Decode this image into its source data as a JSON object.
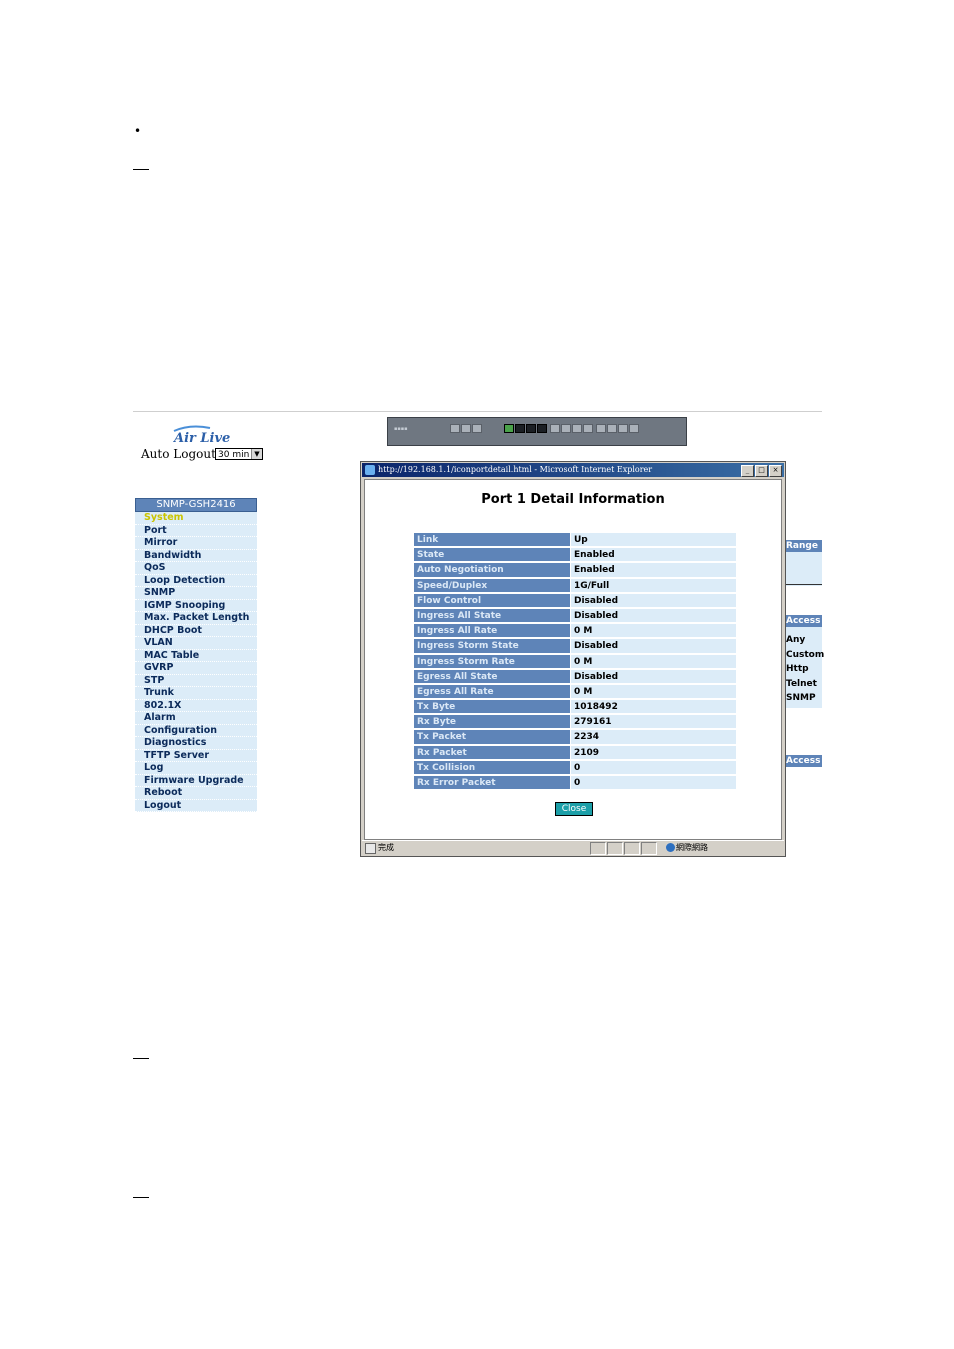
{
  "doc": {
    "bullet": "•"
  },
  "logo": {
    "text": "Air Live"
  },
  "auto_logout": {
    "label": "Auto Logout",
    "value": "30 min"
  },
  "sidebar": {
    "title": "SNMP-GSH2416",
    "items": [
      {
        "label": "System",
        "active": true
      },
      {
        "label": "Port"
      },
      {
        "label": "Mirror"
      },
      {
        "label": "Bandwidth"
      },
      {
        "label": "QoS"
      },
      {
        "label": "Loop Detection"
      },
      {
        "label": "SNMP"
      },
      {
        "label": "IGMP Snooping"
      },
      {
        "label": "Max. Packet Length"
      },
      {
        "label": "DHCP Boot"
      },
      {
        "label": "VLAN"
      },
      {
        "label": "MAC Table"
      },
      {
        "label": "GVRP"
      },
      {
        "label": "STP"
      },
      {
        "label": "Trunk"
      },
      {
        "label": "802.1X"
      },
      {
        "label": "Alarm"
      },
      {
        "label": "Configuration"
      },
      {
        "label": "Diagnostics"
      },
      {
        "label": "TFTP Server"
      },
      {
        "label": "Log"
      },
      {
        "label": "Firmware Upgrade"
      },
      {
        "label": "Reboot"
      },
      {
        "label": "Logout"
      }
    ]
  },
  "background_right": {
    "range_header": "Range",
    "access_header": "Access",
    "access_items": [
      "Any",
      "Custom",
      "Http",
      "Telnet",
      "SNMP"
    ],
    "access_header2": "Access"
  },
  "window": {
    "title": "http://192.168.1.1/iconportdetail.html - Microsoft Internet Explorer",
    "heading": "Port 1 Detail Information",
    "rows": [
      {
        "key": "Link",
        "value": "Up"
      },
      {
        "key": "State",
        "value": "Enabled"
      },
      {
        "key": "Auto Negotiation",
        "value": "Enabled"
      },
      {
        "key": "Speed/Duplex",
        "value": "1G/Full"
      },
      {
        "key": "Flow Control",
        "value": "Disabled"
      },
      {
        "key": "Ingress All State",
        "value": "Disabled"
      },
      {
        "key": "Ingress All Rate",
        "value": "0 M"
      },
      {
        "key": "Ingress Storm State",
        "value": "Disabled"
      },
      {
        "key": "Ingress Storm Rate",
        "value": "0 M"
      },
      {
        "key": "Egress All State",
        "value": "Disabled"
      },
      {
        "key": "Egress All Rate",
        "value": "0 M"
      },
      {
        "key": "Tx Byte",
        "value": "1018492"
      },
      {
        "key": "Rx Byte",
        "value": "279161"
      },
      {
        "key": "Tx Packet",
        "value": "2234"
      },
      {
        "key": "Rx Packet",
        "value": "2109"
      },
      {
        "key": "Tx Collision",
        "value": "0"
      },
      {
        "key": "Rx Error Packet",
        "value": "0"
      }
    ],
    "close_label": "Close",
    "status_text": "完成",
    "zone_text": "網際網路",
    "buttons": {
      "minimize": "_",
      "maximize": "□",
      "close": "×"
    }
  }
}
